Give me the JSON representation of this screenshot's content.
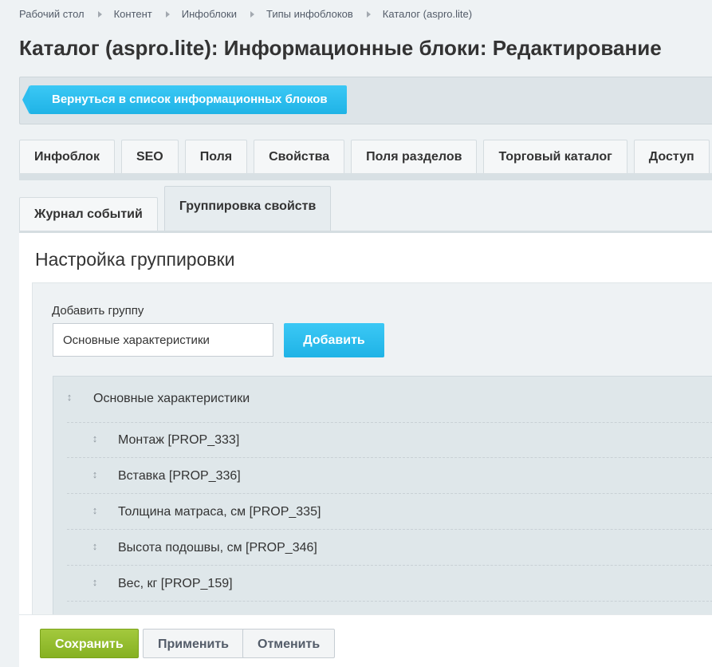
{
  "breadcrumbs": [
    "Рабочий стол",
    "Контент",
    "Инфоблоки",
    "Типы инфоблоков",
    "Каталог (aspro.lite)"
  ],
  "page_title": "Каталог (aspro.lite): Информационные блоки: Редактирование",
  "back_button": "Вернуться в список информационных блоков",
  "tabs_row1": [
    "Инфоблок",
    "SEO",
    "Поля",
    "Свойства",
    "Поля разделов",
    "Торговый каталог",
    "Доступ"
  ],
  "tabs_row2": [
    "Журнал событий",
    "Группировка свойств"
  ],
  "active_tab": "Группировка свойств",
  "section_title": "Настройка группировки",
  "add_group": {
    "label": "Добавить группу",
    "input_value": "Основные характеристики",
    "button": "Добавить"
  },
  "group": {
    "title": "Основные характеристики",
    "properties": [
      "Монтаж [PROP_333]",
      "Вставка [PROP_336]",
      "Толщина матраса, см [PROP_335]",
      "Высота подошвы, см [PROP_346]",
      "Вес, кг [PROP_159]"
    ]
  },
  "footer": {
    "save": "Сохранить",
    "apply": "Применить",
    "cancel": "Отменить"
  },
  "colors": {
    "accent_blue": "#1fb3e6",
    "save_green": "#86b122"
  },
  "icons": {
    "breadcrumb_separator": "triangle-right-icon",
    "drag": "drag-handle-icon"
  }
}
